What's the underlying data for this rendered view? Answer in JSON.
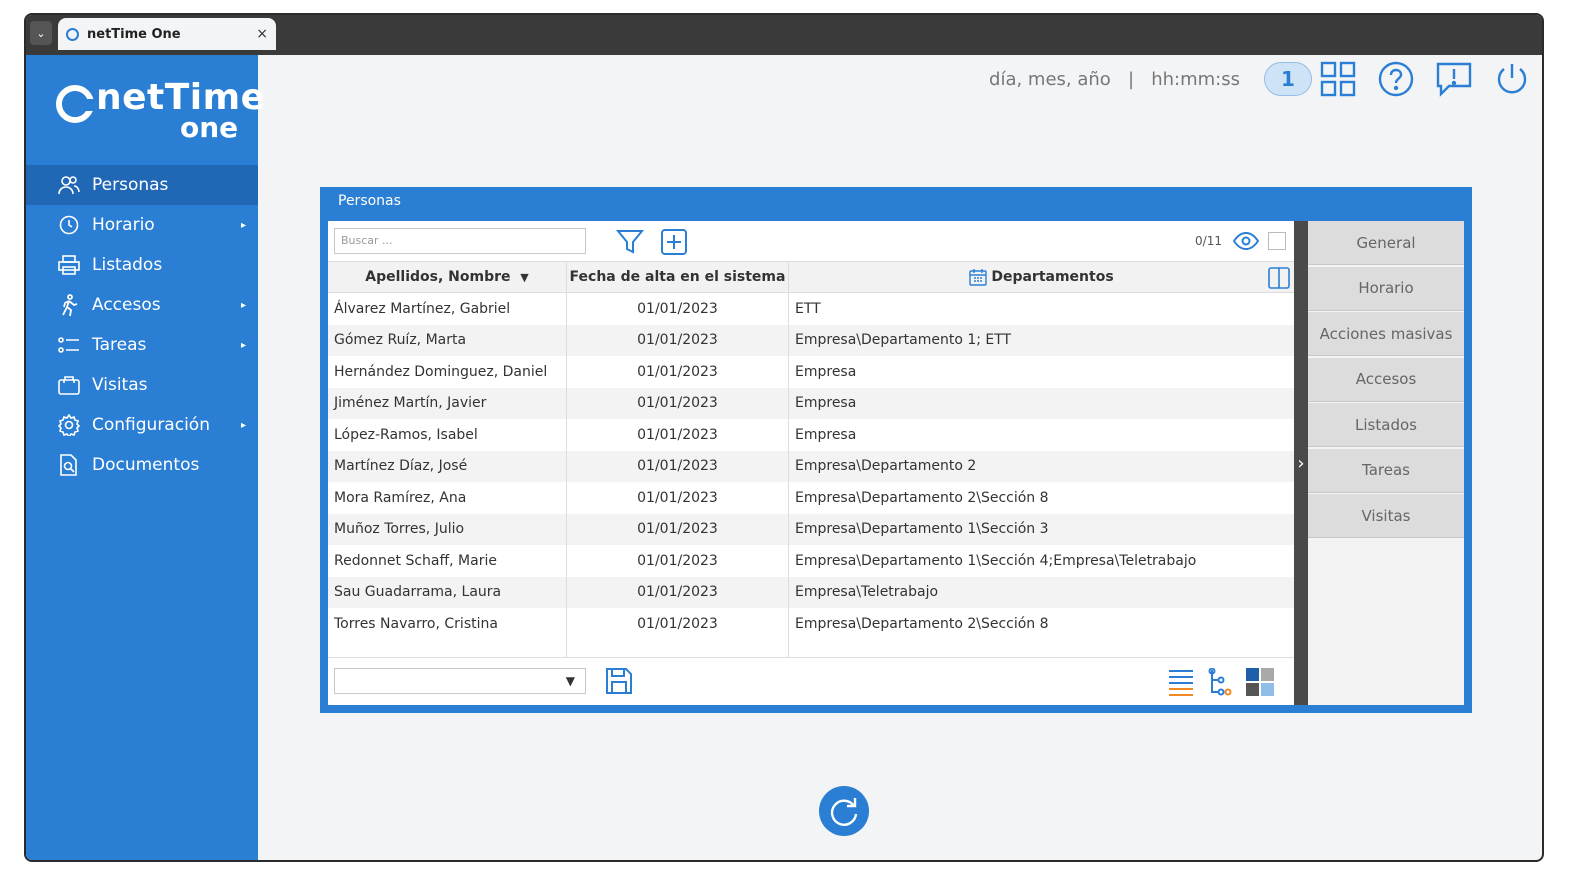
{
  "browser": {
    "tab_title": "netTime One",
    "close": "×",
    "dropdown": "⌄"
  },
  "logo": {
    "word1": "netTime",
    "word2": "one"
  },
  "sidebar": {
    "items": [
      {
        "label": "Personas",
        "icon": "people-icon",
        "active": true,
        "submenu": false
      },
      {
        "label": "Horario",
        "icon": "clock-icon",
        "submenu": true
      },
      {
        "label": "Listados",
        "icon": "printer-icon",
        "submenu": false
      },
      {
        "label": "Accesos",
        "icon": "walking-person-icon",
        "submenu": true
      },
      {
        "label": "Tareas",
        "icon": "checklist-icon",
        "submenu": true
      },
      {
        "label": "Visitas",
        "icon": "briefcase-icon",
        "submenu": false
      },
      {
        "label": "Configuración",
        "icon": "gear-icon",
        "submenu": true
      },
      {
        "label": "Documentos",
        "icon": "document-search-icon",
        "submenu": false
      }
    ],
    "submenu_arrow": "▸"
  },
  "header": {
    "date_format": "día, mes, año",
    "separator": "|",
    "time_format": "hh:mm:ss",
    "badge": "1"
  },
  "panel": {
    "title": "Personas",
    "search_placeholder": "Buscar ...",
    "count": "0/11",
    "columns": {
      "name": "Apellidos, Nombre",
      "sort": "▼",
      "date": "Fecha de alta en el sistema",
      "dept": "Departamentos"
    },
    "rows": [
      {
        "name": "Álvarez Martínez, Gabriel",
        "date": "01/01/2023",
        "dept": "ETT"
      },
      {
        "name": "Gómez Ruíz, Marta",
        "date": "01/01/2023",
        "dept": "Empresa\\Departamento 1; ETT"
      },
      {
        "name": "Hernández Dominguez, Daniel",
        "date": "01/01/2023",
        "dept": "Empresa"
      },
      {
        "name": "Jiménez Martín, Javier",
        "date": "01/01/2023",
        "dept": "Empresa"
      },
      {
        "name": "López-Ramos, Isabel",
        "date": "01/01/2023",
        "dept": "Empresa"
      },
      {
        "name": "Martínez Díaz, José",
        "date": "01/01/2023",
        "dept": "Empresa\\Departamento 2"
      },
      {
        "name": "Mora Ramírez, Ana",
        "date": "01/01/2023",
        "dept": "Empresa\\Departamento 2\\Sección 8"
      },
      {
        "name": "Muñoz Torres, Julio",
        "date": "01/01/2023",
        "dept": "Empresa\\Departamento 1\\Sección 3"
      },
      {
        "name": "Redonnet Schaff, Marie",
        "date": "01/01/2023",
        "dept": "Empresa\\Departamento 1\\Sección 4;Empresa\\Teletrabajo"
      },
      {
        "name": "Sau Guadarrama, Laura",
        "date": "01/01/2023",
        "dept": "Empresa\\Teletrabajo"
      },
      {
        "name": "Torres Navarro, Cristina",
        "date": "01/01/2023",
        "dept": "Empresa\\Departamento 2\\Sección 8"
      }
    ],
    "footer_select_arrow": "▼",
    "splitter_arrow": "›"
  },
  "right_tabs": [
    "General",
    "Horario",
    "Acciones masivas",
    "Accesos",
    "Listados",
    "Tareas",
    "Visitas"
  ],
  "colors": {
    "brand": "#2a7fd4",
    "brand_dark": "#2068b6",
    "accent_orange": "#f08a24"
  }
}
